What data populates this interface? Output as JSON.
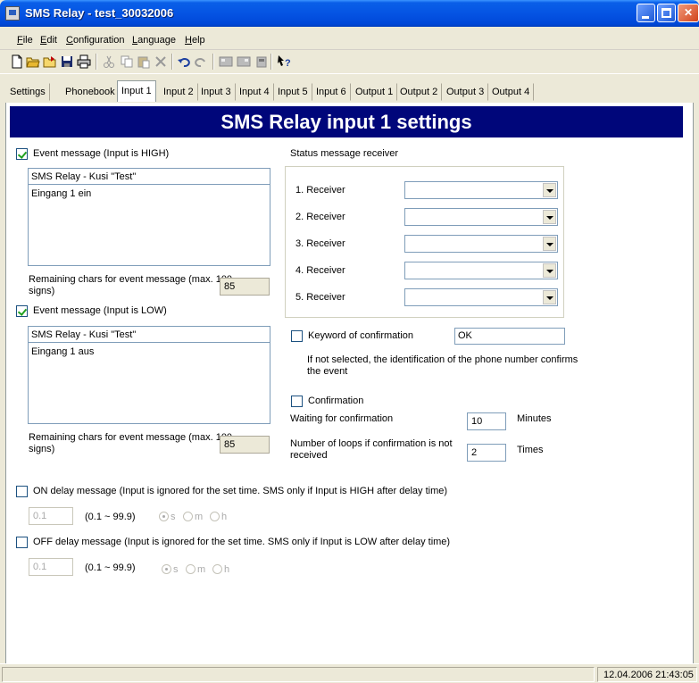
{
  "window": {
    "title": "SMS Relay - test_30032006"
  },
  "menu": [
    "File",
    "Edit",
    "Configuration",
    "Language",
    "Help"
  ],
  "tabs": [
    "Settings",
    "Phonebook",
    "Input 1",
    "Input 2",
    "Input 3",
    "Input 4",
    "Input 5",
    "Input 6",
    "Output 1",
    "Output 2",
    "Output 3",
    "Output 4"
  ],
  "active_tab": "Input 1",
  "banner": "SMS Relay input 1 settings",
  "high": {
    "checkbox_label": "Event message (Input is HIGH)",
    "checked": true,
    "subject": "SMS Relay - Kusi \"Test\"",
    "body": "Eingang 1 ein",
    "remaining_label_1": "Remaining chars for event message (max. 100",
    "remaining_label_2": "signs)",
    "remaining": "85"
  },
  "low": {
    "checkbox_label": "Event message (Input is LOW)",
    "checked": true,
    "subject": "SMS Relay - Kusi \"Test\"",
    "body": "Eingang 1 aus",
    "remaining_label_1": "Remaining chars for event message (max. 100",
    "remaining_label_2": "signs)",
    "remaining": "85"
  },
  "receivers": {
    "title": "Status message receiver",
    "items": [
      "1. Receiver",
      "2. Receiver",
      "3. Receiver",
      "4. Receiver",
      "5. Receiver"
    ],
    "values": [
      "",
      "",
      "",
      "",
      ""
    ]
  },
  "keyword": {
    "checkbox_label": "Keyword of confirmation",
    "checked": false,
    "value": "OK",
    "note_1": "If not selected, the identification of the phone number confirms",
    "note_2": "the event"
  },
  "confirmation": {
    "checkbox_label": "Confirmation",
    "checked": false,
    "waiting_label": "Waiting for confirmation",
    "waiting_value": "10",
    "waiting_unit": "Minutes",
    "loops_label_1": "Number of loops if confirmation is not",
    "loops_label_2": "received",
    "loops_value": "2",
    "loops_unit": "Times"
  },
  "on_delay": {
    "checkbox_label": "ON delay message (Input is ignored for the set time. SMS only if Input is HIGH after delay time)",
    "checked": false,
    "value": "0.1",
    "range": "(0.1 ~ 99.9)",
    "units": [
      "s",
      "m",
      "h"
    ],
    "selected_unit": "s"
  },
  "off_delay": {
    "checkbox_label": "OFF delay message (Input is ignored for the set time. SMS only if Input is LOW after delay time)",
    "checked": false,
    "value": "0.1",
    "range": "(0.1 ~ 99.9)",
    "units": [
      "s",
      "m",
      "h"
    ],
    "selected_unit": "s"
  },
  "status": {
    "clock": "12.04.2006 21:43:05"
  },
  "colors": {
    "banner_bg": "#00067a",
    "titlebar": "#0554e3"
  },
  "toolbar_icons": [
    "new-icon",
    "open-icon",
    "open-folder-icon",
    "save-icon",
    "print-icon",
    "cut-icon",
    "copy-icon",
    "paste-icon",
    "delete-icon",
    "undo-icon",
    "redo-icon",
    "upload-icon",
    "download-icon",
    "device-icon",
    "help-icon"
  ]
}
